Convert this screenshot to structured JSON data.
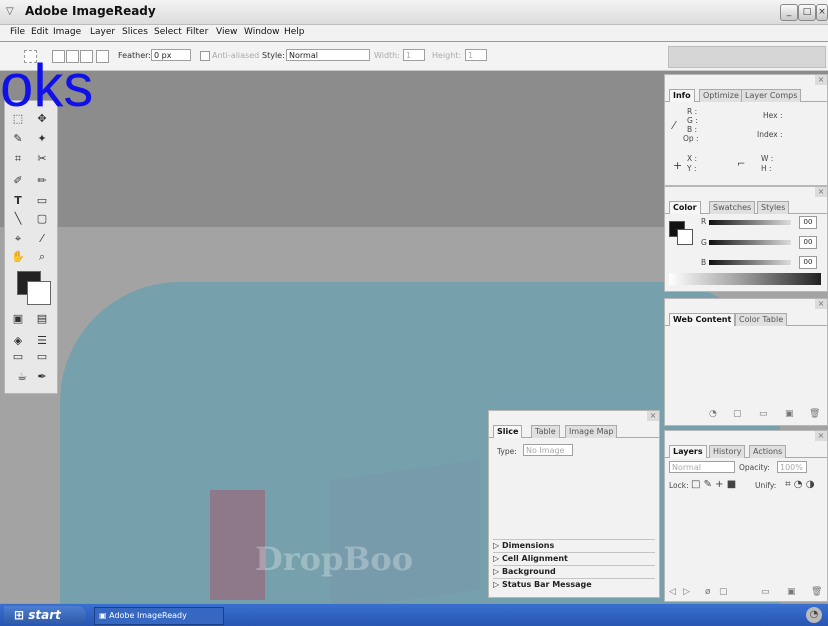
{
  "window": {
    "title": "Adobe ImageReady",
    "app_icon": "ImageReady",
    "controls": [
      "_",
      "□",
      "×"
    ]
  },
  "menu": [
    "File",
    "Edit",
    "Image",
    "Layer",
    "Slices",
    "Select",
    "Filter",
    "View",
    "Window",
    "Help"
  ],
  "options": {
    "feather_label": "Feather:",
    "feather_value": "0 px",
    "anti_alias_label": "Anti-aliased",
    "style_label": "Style:",
    "style_value": "Normal",
    "width_label": "Width:",
    "width_value": "1",
    "height_label": "Height:",
    "height_value": "1"
  },
  "overlay_text": "oks",
  "watermark_text": "DropBoo",
  "info_palette": {
    "tabs": [
      "Info",
      "Optimize",
      "Layer Comps"
    ],
    "r": "R :",
    "g": "G :",
    "b": "B :",
    "op": "Op :",
    "hex": "Hex :",
    "index": "Index :",
    "x": "X :",
    "y": "Y :",
    "w": "W :",
    "h": "H :"
  },
  "color_palette": {
    "tabs": [
      "Color",
      "Swatches",
      "Styles"
    ],
    "channels": [
      {
        "label": "R",
        "value": "00"
      },
      {
        "label": "G",
        "value": "00"
      },
      {
        "label": "B",
        "value": "00"
      }
    ]
  },
  "web_palette": {
    "tabs": [
      "Web Content",
      "Color Table"
    ]
  },
  "slice_palette": {
    "tabs": [
      "Slice",
      "Table",
      "Image Map"
    ],
    "type_label": "Type:",
    "type_value": "No Image",
    "sections": [
      "Dimensions",
      "Cell Alignment",
      "Background",
      "Status Bar Message"
    ]
  },
  "layers_palette": {
    "tabs": [
      "Layers",
      "History",
      "Actions"
    ],
    "blend_mode": "Normal",
    "opacity_label": "Opacity:",
    "opacity_value": "100%",
    "lock_label": "Lock:",
    "unify_label": "Unify:"
  },
  "taskbar": {
    "start": "start",
    "task": "Adobe ImageReady"
  }
}
